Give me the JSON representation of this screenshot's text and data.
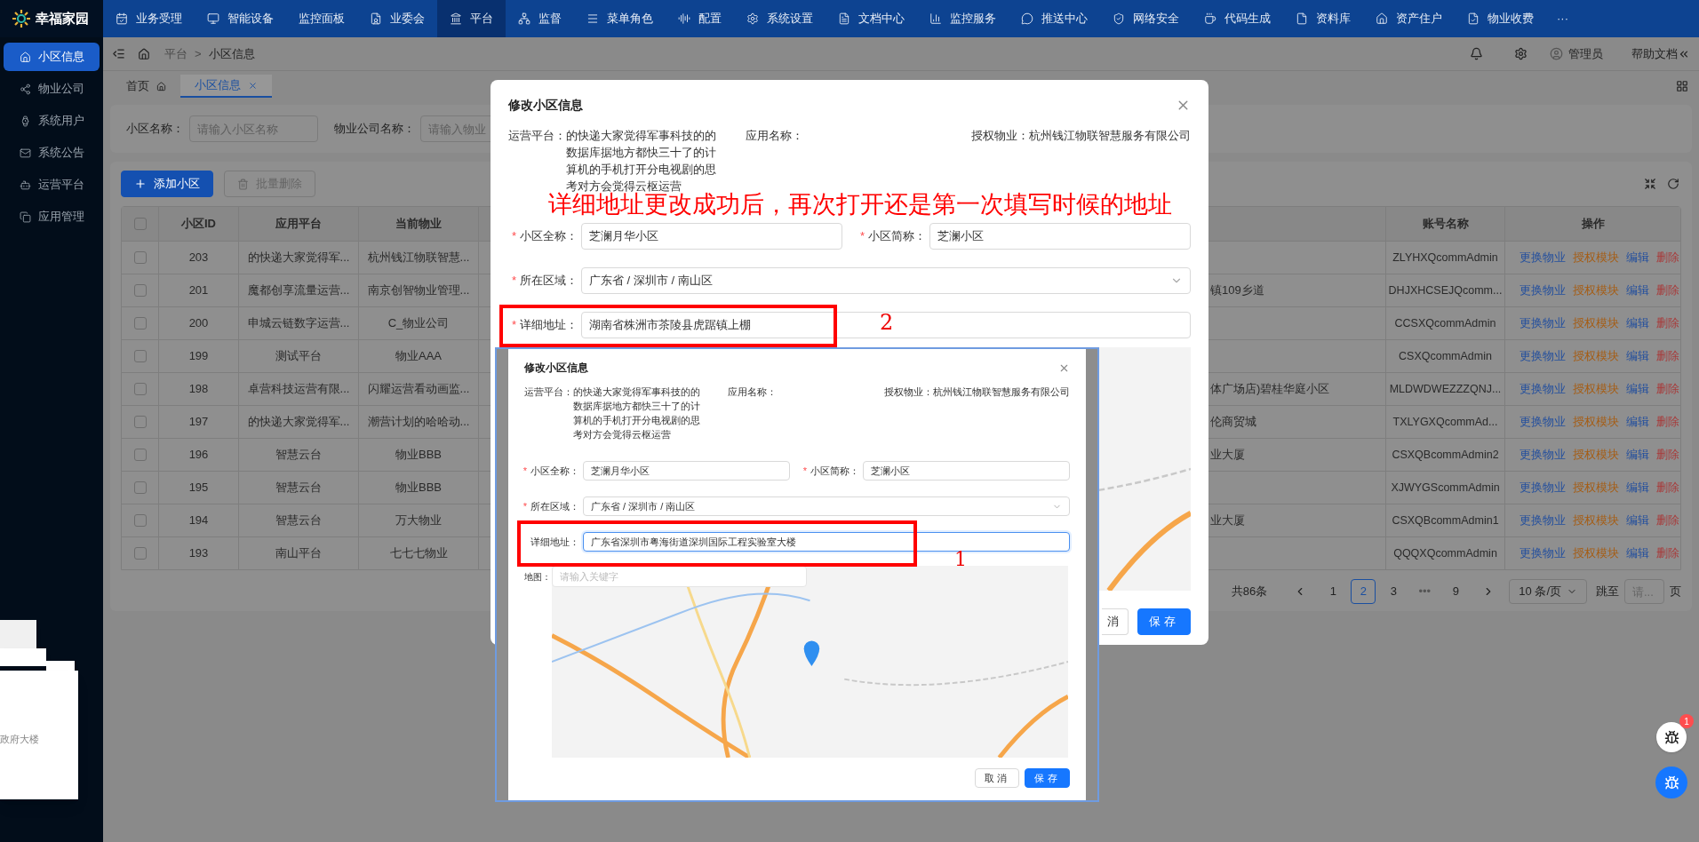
{
  "top_nav": {
    "logo_text": "幸福家园",
    "items": [
      {
        "label": "业务受理",
        "selected": false
      },
      {
        "label": "智能设备",
        "selected": false
      },
      {
        "label": "监控面板",
        "selected": false
      },
      {
        "label": "业委会",
        "selected": false
      },
      {
        "label": "平台",
        "selected": true
      },
      {
        "label": "监督",
        "selected": false
      },
      {
        "label": "菜单角色",
        "selected": false
      },
      {
        "label": "配置",
        "selected": false
      },
      {
        "label": "系统设置",
        "selected": false
      },
      {
        "label": "文档中心",
        "selected": false
      },
      {
        "label": "监控服务",
        "selected": false
      },
      {
        "label": "推送中心",
        "selected": false
      },
      {
        "label": "网络安全",
        "selected": false
      },
      {
        "label": "代码生成",
        "selected": false
      },
      {
        "label": "资料库",
        "selected": false
      },
      {
        "label": "资产住户",
        "selected": false
      },
      {
        "label": "物业收费",
        "selected": false
      }
    ],
    "more": "···"
  },
  "sidebar": {
    "items": [
      {
        "label": "小区信息",
        "selected": true
      },
      {
        "label": "物业公司",
        "selected": false
      },
      {
        "label": "系统用户",
        "selected": false
      },
      {
        "label": "系统公告",
        "selected": false
      },
      {
        "label": "运营平台",
        "selected": false
      },
      {
        "label": "应用管理",
        "selected": false
      }
    ]
  },
  "header": {
    "breadcrumb": [
      "平台",
      "小区信息"
    ],
    "separator": ">",
    "user": "管理员",
    "help": "帮助文档"
  },
  "tabs": [
    {
      "label": "首页",
      "selected": false,
      "closable": false
    },
    {
      "label": "小区信息",
      "selected": true,
      "closable": true
    }
  ],
  "search": {
    "fields": [
      {
        "label": "小区名称：",
        "placeholder": "请输入小区名称"
      },
      {
        "label": "物业公司名称：",
        "placeholder": "请输入物业"
      }
    ]
  },
  "toolbar": {
    "buttons": [
      {
        "label": "添加小区",
        "kind": "primary",
        "disabled": false
      },
      {
        "label": "批量删除",
        "kind": "delete",
        "disabled": true
      }
    ]
  },
  "table": {
    "columns": [
      "小区ID",
      "应用平台",
      "当前物业",
      "账号名称",
      "操作"
    ],
    "all_checked": false,
    "rows": [
      {
        "checked": false,
        "id": "203",
        "platform": "的快递大家觉得军...",
        "property": "杭州钱江物联智慧...",
        "account": "ZLYHXQcommAdmin",
        "actions": [
          {
            "label": "更换物业",
            "kind": "primary"
          },
          {
            "label": "授权模块",
            "kind": "warning"
          },
          {
            "label": "编辑",
            "kind": "primary"
          },
          {
            "label": "删除",
            "kind": "danger"
          }
        ]
      },
      {
        "checked": false,
        "id": "201",
        "platform": "魔都创享流量运营...",
        "property": "南京创智物业管理...",
        "column_4": "镇109乡道",
        "account": "DHJXHCSEJQcomm...",
        "actions": [
          {
            "label": "更换物业",
            "kind": "primary"
          },
          {
            "label": "授权模块",
            "kind": "warning"
          },
          {
            "label": "编辑",
            "kind": "primary"
          },
          {
            "label": "删除",
            "kind": "danger"
          }
        ]
      },
      {
        "checked": false,
        "id": "200",
        "platform": "申城云链数字运营...",
        "property": "C_物业公司",
        "account": "CCSXQcommAdmin",
        "actions": [
          {
            "label": "更换物业",
            "kind": "primary"
          },
          {
            "label": "授权模块",
            "kind": "warning"
          },
          {
            "label": "编辑",
            "kind": "primary"
          },
          {
            "label": "删除",
            "kind": "danger"
          }
        ]
      },
      {
        "checked": false,
        "id": "199",
        "platform": "测试平台",
        "property": "物业AAA",
        "account": "CSXQcommAdmin",
        "actions": [
          {
            "label": "更换物业",
            "kind": "primary"
          },
          {
            "label": "授权模块",
            "kind": "warning"
          },
          {
            "label": "编辑",
            "kind": "primary"
          },
          {
            "label": "删除",
            "kind": "danger"
          }
        ]
      },
      {
        "checked": false,
        "id": "198",
        "platform": "卓营科技运营有限...",
        "property": "闪耀运营看动画监...",
        "column_4": "体广场店)碧桂华庭小区",
        "account": "MLDWDWEZZZQNJ...",
        "actions": [
          {
            "label": "更换物业",
            "kind": "primary"
          },
          {
            "label": "授权模块",
            "kind": "warning"
          },
          {
            "label": "编辑",
            "kind": "primary"
          },
          {
            "label": "删除",
            "kind": "danger"
          }
        ]
      },
      {
        "checked": false,
        "id": "197",
        "platform": "的快递大家觉得军...",
        "property": "潮营计划的哈哈动...",
        "column_4": "伦商贸城",
        "account": "TXLYGXQcommAd...",
        "actions": [
          {
            "label": "更换物业",
            "kind": "primary"
          },
          {
            "label": "授权模块",
            "kind": "warning"
          },
          {
            "label": "编辑",
            "kind": "primary"
          },
          {
            "label": "删除",
            "kind": "danger"
          }
        ]
      },
      {
        "checked": false,
        "id": "196",
        "platform": "智慧云台",
        "property": "物业BBB",
        "column_4": "业大厦",
        "account": "CSXQBcommAdmin2",
        "actions": [
          {
            "label": "更换物业",
            "kind": "primary"
          },
          {
            "label": "授权模块",
            "kind": "warning"
          },
          {
            "label": "编辑",
            "kind": "primary"
          },
          {
            "label": "删除",
            "kind": "danger"
          }
        ]
      },
      {
        "checked": false,
        "id": "195",
        "platform": "智慧云台",
        "property": "物业BBB",
        "account": "XJWYGScommAdmin",
        "actions": [
          {
            "label": "更换物业",
            "kind": "primary"
          },
          {
            "label": "授权模块",
            "kind": "warning"
          },
          {
            "label": "编辑",
            "kind": "primary"
          },
          {
            "label": "删除",
            "kind": "danger"
          }
        ]
      },
      {
        "checked": false,
        "id": "194",
        "platform": "智慧云台",
        "property": "万大物业",
        "column_4": "业大厦",
        "account": "CSXQBcommAdmin1",
        "actions": [
          {
            "label": "更换物业",
            "kind": "primary"
          },
          {
            "label": "授权模块",
            "kind": "warning"
          },
          {
            "label": "编辑",
            "kind": "primary"
          },
          {
            "label": "删除",
            "kind": "danger"
          }
        ]
      },
      {
        "checked": false,
        "id": "193",
        "platform": "南山平台",
        "property": "七七七物业",
        "account": "QQQXQcommAdmin",
        "actions": [
          {
            "label": "更换物业",
            "kind": "primary"
          },
          {
            "label": "授权模块",
            "kind": "warning"
          },
          {
            "label": "编辑",
            "kind": "primary"
          },
          {
            "label": "删除",
            "kind": "danger"
          }
        ]
      }
    ]
  },
  "pagination": {
    "total": "共86条",
    "pages": [
      {
        "label": "1",
        "kind": "page",
        "selected": false
      },
      {
        "label": "2",
        "kind": "page",
        "selected": true
      },
      {
        "label": "3",
        "kind": "page",
        "selected": false
      },
      {
        "label": "•••",
        "kind": "ellipsis",
        "selected": false
      },
      {
        "label": "9",
        "kind": "page",
        "selected": false
      }
    ],
    "page_size": "10 条/页",
    "jump_label": "跳至",
    "jump_placeholder": "请...",
    "page_suffix": "页"
  },
  "desktop_preview": {
    "text": "政府大楼"
  },
  "floating": {
    "badge": "1"
  },
  "modal": {
    "title": "修改小区信息",
    "info": [
      {
        "label": "运营平台：",
        "value": "的快递大家觉得军事科技的的数据库据地方都快三十了的计算机的手机打开分电视剧的思考对方会觉得云枢运营"
      },
      {
        "label": "应用名称："
      },
      {
        "label": "授权物业：",
        "value": "杭州钱江物联智慧服务有限公司"
      }
    ],
    "annotation": "详细地址更改成功后，再次打开还是第一次填写时候的地址",
    "fields": [
      {
        "label": "小区全称：",
        "value": "芝澜月华小区",
        "required": true,
        "kind": "input",
        "focused": false
      },
      {
        "label": "小区简称：",
        "value": "芝澜小区",
        "required": true,
        "kind": "input",
        "focused": false
      },
      {
        "label": "所在区域：",
        "value": "广东省 / 深圳市 / 南山区",
        "required": true,
        "kind": "select",
        "focused": false
      },
      {
        "label": "详细地址：",
        "value": "湖南省株洲市茶陵县虎踞镇上棚",
        "required": true,
        "kind": "input",
        "focused": false
      }
    ],
    "marker": "2",
    "required_mark": "*",
    "buttons": [
      {
        "label": "消",
        "kind": "default"
      },
      {
        "label": "保存",
        "kind": "primary"
      }
    ]
  },
  "pasted_screenshot": {
    "title": "修改小区信息",
    "info": [
      {
        "label": "运营平台：",
        "value": "的快递大家觉得军事科技的的数据库据地方都快三十了的计算机的手机打开分电视剧的思考对方会觉得云枢运营"
      },
      {
        "label": "应用名称："
      },
      {
        "label": "授权物业：",
        "value": "杭州钱江物联智慧服务有限公司"
      }
    ],
    "fields": [
      {
        "label": "小区全称：",
        "value": "芝澜月华小区",
        "required": true,
        "kind": "input",
        "focused": false
      },
      {
        "label": "小区简称：",
        "value": "芝澜小区",
        "required": true,
        "kind": "input",
        "focused": false
      },
      {
        "label": "所在区域：",
        "value": "广东省 / 深圳市 / 南山区",
        "required": true,
        "kind": "select",
        "focused": false
      },
      {
        "label": "详细地址：",
        "value": "广东省深圳市粤海街道深圳国际工程实验室大楼",
        "required": false,
        "kind": "input",
        "focused": true
      }
    ],
    "map_label": "地图：",
    "map_placeholder": "请输入关键字",
    "marker": "1",
    "required_mark": "*",
    "buttons": [
      {
        "label": "取消",
        "kind": "default"
      },
      {
        "label": "保存",
        "kind": "primary"
      }
    ]
  }
}
